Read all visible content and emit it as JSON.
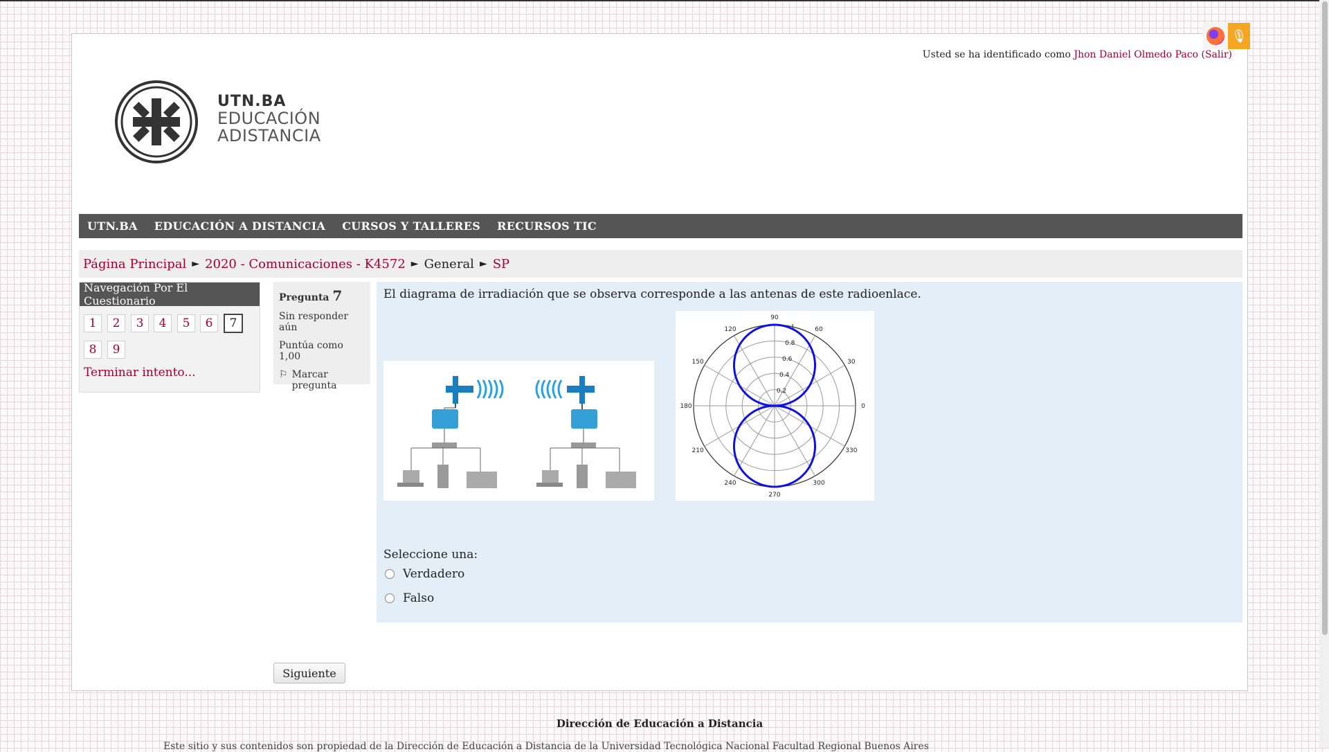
{
  "login": {
    "prefix": "Usted se ha identificado como",
    "user": "Jhon Daniel Olmedo Paco",
    "logout": "(Salir)"
  },
  "logo": {
    "line1": "UTN.BA",
    "line2": "EDUCACIÓN",
    "line3": "ADISTANCIA"
  },
  "nav": {
    "items": [
      "UTN.BA",
      "EDUCACIÓN A DISTANCIA",
      "CURSOS Y TALLERES",
      "RECURSOS TIC"
    ]
  },
  "breadcrumb": {
    "items": [
      "Página Principal",
      "2020 - Comunicaciones - K4572",
      "General",
      "SP"
    ],
    "separator": "►"
  },
  "quiz_nav": {
    "title": "Navegación Por El Cuestionario",
    "buttons": [
      "1",
      "2",
      "3",
      "4",
      "5",
      "6",
      "7",
      "8",
      "9"
    ],
    "current": "7",
    "finish": "Terminar intento..."
  },
  "question": {
    "label": "Pregunta",
    "number": "7",
    "status": "Sin responder aún",
    "score": "Puntúa como 1,00",
    "flag": "Marcar pregunta",
    "text": "El diagrama de irradiación que se observa corresponde a las antenas de este radioenlace.",
    "prompt": "Seleccione una:",
    "options": [
      "Verdadero",
      "Falso"
    ]
  },
  "polar_diagram": {
    "angle_labels": [
      "90",
      "60",
      "30",
      "0",
      "330",
      "300",
      "270",
      "240",
      "210",
      "180",
      "150",
      "120"
    ],
    "radius_labels": [
      "1",
      "0.8",
      "0.6",
      "0.4",
      "0.2"
    ],
    "pattern_color": "#1010e0"
  },
  "next_button": "Siguiente",
  "footer": {
    "title": "Dirección de Educación a Distancia",
    "text": "Este sitio y sus contenidos son propiedad de la Dirección de Educación a Distancia de la Universidad Tecnológica Nacional Facultad Regional Buenos Aires"
  },
  "colors": {
    "link": "#a00030",
    "navbar": "#555555",
    "question_bg": "#e3eef7",
    "mic_extension": "#f5a623"
  }
}
